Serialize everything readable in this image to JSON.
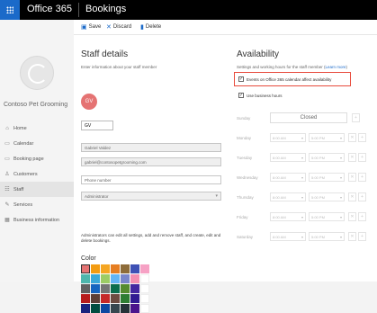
{
  "header": {
    "suite": "Office 365",
    "app": "Bookings"
  },
  "sidebar": {
    "business": "Contoso Pet Grooming",
    "items": [
      {
        "label": "Home",
        "icon": "home-icon",
        "glyph": "⌂"
      },
      {
        "label": "Calendar",
        "icon": "calendar-icon",
        "glyph": "▭"
      },
      {
        "label": "Booking page",
        "icon": "booking-page-icon",
        "glyph": "▭"
      },
      {
        "label": "Customers",
        "icon": "customers-icon",
        "glyph": "♙"
      },
      {
        "label": "Staff",
        "icon": "staff-icon",
        "glyph": "☷"
      },
      {
        "label": "Services",
        "icon": "services-icon",
        "glyph": "✎"
      },
      {
        "label": "Business information",
        "icon": "business-info-icon",
        "glyph": "▦"
      }
    ]
  },
  "toolbar": {
    "save": "Save",
    "discard": "Discard",
    "delete": "Delete"
  },
  "staff": {
    "title": "Staff details",
    "subtitle": "Enter information about your staff member",
    "avatar_initials": "GV",
    "initials_value": "GV",
    "name_value": "Gabriel Valdez",
    "email_value": "gabriel@contosopetgrooming.com",
    "phone_placeholder": "Phone number",
    "role_value": "Administrator",
    "role_desc": "Administrators can edit all settings, add and remove staff, and create, edit and delete bookings.",
    "color_label": "Color",
    "colors": [
      "#e57373",
      "#f39c12",
      "#f5a623",
      "#e67e22",
      "#8e6c3a",
      "#3f51b5",
      "#f6a1c4",
      "#4db6ac",
      "#3aa9d9",
      "#9ccc65",
      "#64b5f6",
      "#7986cb",
      "#f48fb1",
      "#ffffff",
      "#616161",
      "#1565c0",
      "#757575",
      "#0b6e4f",
      "#558b2f",
      "#4527a0",
      "#ffffff",
      "#b71c1c",
      "#5d4037",
      "#c62828",
      "#6d4c41",
      "#2e7d32",
      "#311b92",
      "#ffffff",
      "#1a237e",
      "#004d40",
      "#0d47a1",
      "#37474f",
      "#263238",
      "#4a148c",
      "#ffffff"
    ]
  },
  "availability": {
    "title": "Availability",
    "subtitle": "Settings and working hours for the staff member",
    "learn_more": "Learn more",
    "event_check": "Events on Office 365 calendar affect availability",
    "business_hours": "Use business hours",
    "closed_label": "Closed",
    "rows": [
      {
        "day": "Sunday",
        "closed": true
      },
      {
        "day": "Monday",
        "start": "8:00 AM",
        "end": "5:00 PM"
      },
      {
        "day": "Tuesday",
        "start": "8:00 AM",
        "end": "5:00 PM"
      },
      {
        "day": "Wednesday",
        "start": "8:00 AM",
        "end": "5:00 PM"
      },
      {
        "day": "Thursday",
        "start": "8:00 AM",
        "end": "5:00 PM"
      },
      {
        "day": "Friday",
        "start": "8:00 AM",
        "end": "5:00 PM"
      },
      {
        "day": "Saturday",
        "start": "8:00 AM",
        "end": "5:00 PM"
      }
    ]
  },
  "colors": {
    "accent": "#1b6ac9",
    "highlight": "#e84a3c",
    "topbar": "#000000"
  }
}
